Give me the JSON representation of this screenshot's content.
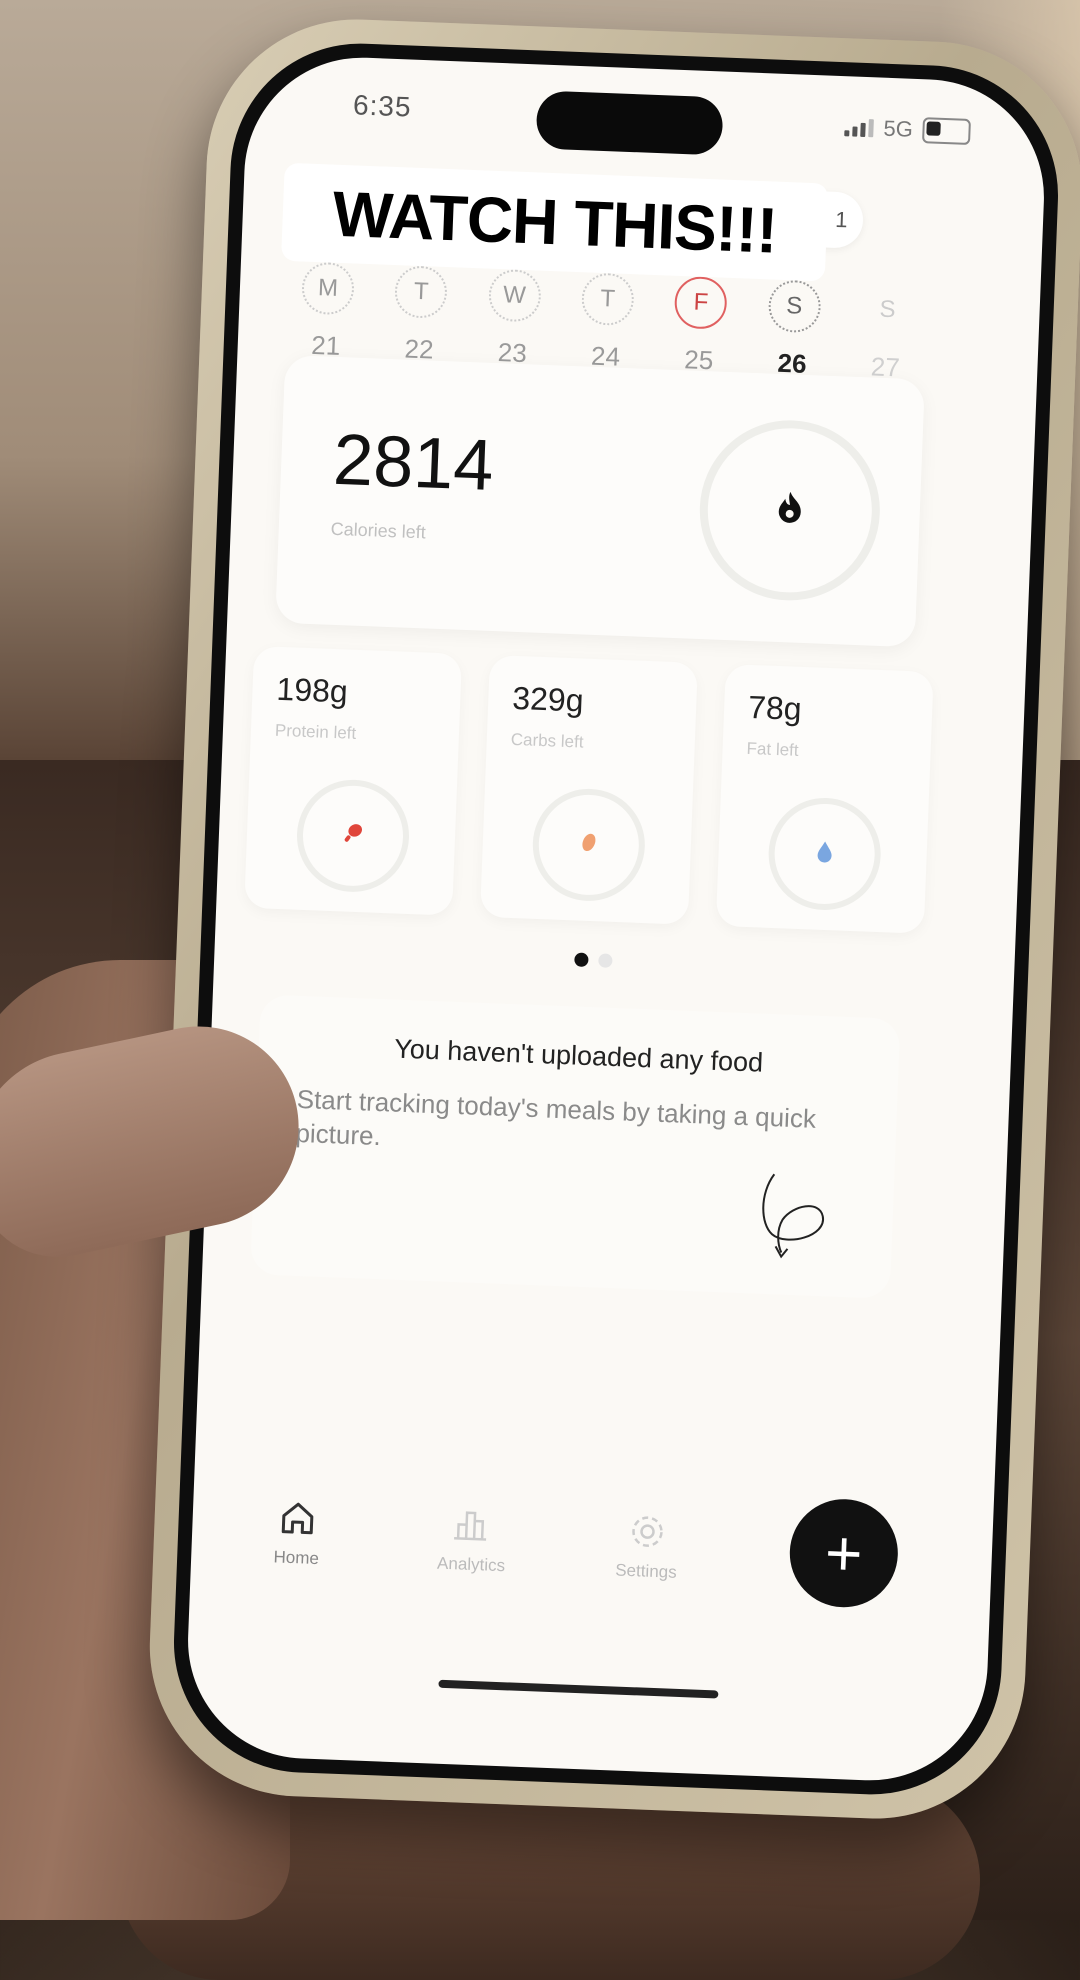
{
  "overlay": {
    "caption": "WATCH THIS!!!"
  },
  "status_bar": {
    "time": "6:35",
    "network": "5G"
  },
  "streak": {
    "count": "1"
  },
  "week": [
    {
      "letter": "M",
      "day": "21"
    },
    {
      "letter": "T",
      "day": "22"
    },
    {
      "letter": "W",
      "day": "23"
    },
    {
      "letter": "T",
      "day": "24"
    },
    {
      "letter": "F",
      "day": "25"
    },
    {
      "letter": "S",
      "day": "26"
    },
    {
      "letter": "S",
      "day": "27"
    }
  ],
  "calories": {
    "value": "2814",
    "label": "Calories left"
  },
  "macros": [
    {
      "value": "198g",
      "label": "Protein left",
      "color": "#e0453a"
    },
    {
      "value": "329g",
      "label": "Carbs left",
      "color": "#f0a070"
    },
    {
      "value": "78g",
      "label": "Fat left",
      "color": "#7aa6e0"
    }
  ],
  "empty_state": {
    "title": "You haven't uploaded any food",
    "subtitle": "Start tracking today's meals by taking a quick picture."
  },
  "nav": {
    "home": "Home",
    "analytics": "Analytics",
    "settings": "Settings"
  },
  "fab": {
    "label": "+"
  }
}
